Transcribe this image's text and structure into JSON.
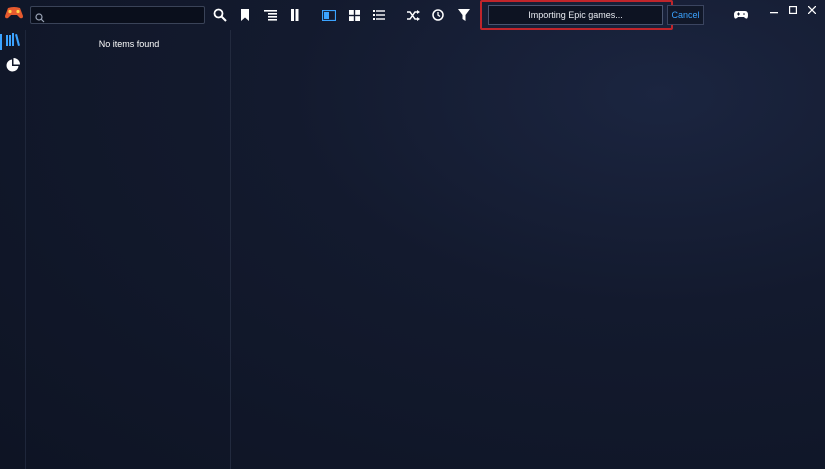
{
  "search": {
    "placeholder": "",
    "value": ""
  },
  "toolbar": {
    "buttons": [
      "search-icon",
      "bookmark-icon",
      "list-indent-icon",
      "bookmarks-icon",
      "details-view-icon",
      "grid-view-icon",
      "list-view-icon",
      "shuffle-icon",
      "clock-icon",
      "filter-icon"
    ]
  },
  "progress": {
    "text": "Importing Epic games..."
  },
  "cancel": {
    "label": "Cancel"
  },
  "sidebar": {
    "items": [
      "library-icon",
      "statistics-icon"
    ]
  },
  "list": {
    "empty_text": "No items found"
  },
  "colors": {
    "accent": "#3ba3ff",
    "highlight": "#c0252b",
    "background": "#131a2e"
  }
}
